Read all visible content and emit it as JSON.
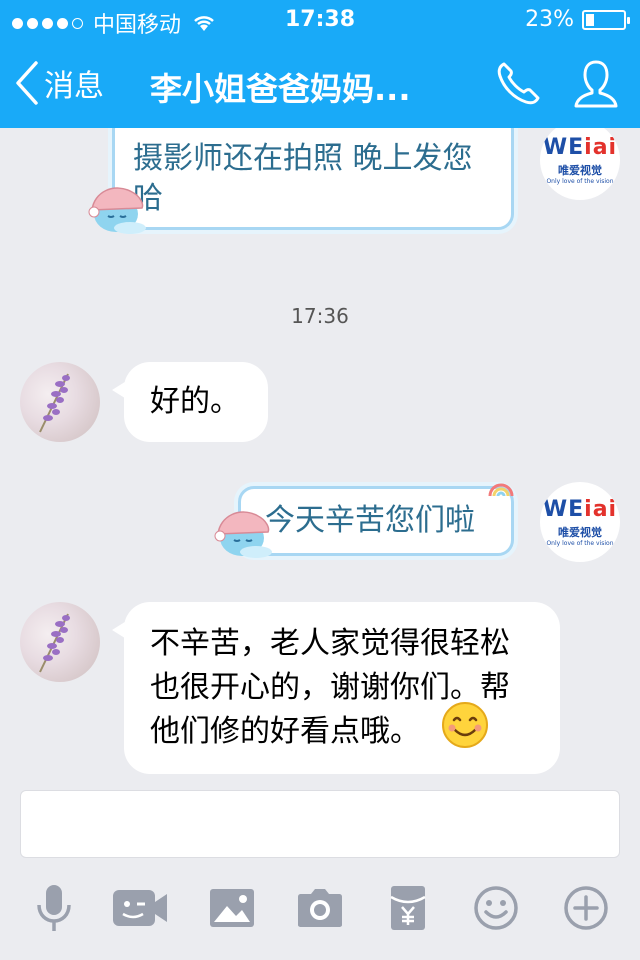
{
  "status": {
    "carrier": "中国移动",
    "time": "17:38",
    "battery": "23%",
    "battery_level": 0.23
  },
  "nav": {
    "back_label": "消息",
    "title": "李小姐爸爸妈妈..."
  },
  "chat": {
    "messages": [
      {
        "from": "me",
        "text": "摄影师还在拍照 晚上发您哈"
      },
      {
        "timestamp": "17:36"
      },
      {
        "from": "other",
        "text": "好的。"
      },
      {
        "from": "me",
        "text": "今天辛苦您们啦"
      },
      {
        "from": "other",
        "text": "不辛苦，老人家觉得很轻松也很开心的，谢谢你们。帮他们修的好看点哦。"
      }
    ],
    "brand_avatar": {
      "logo": "WEiai",
      "cn": "唯爱视觉",
      "en": "Only love of the vision"
    }
  },
  "composer": {
    "input_value": "",
    "tools": [
      "microphone-icon",
      "video-call-icon",
      "image-icon",
      "camera-icon",
      "red-packet-icon",
      "emoji-icon",
      "plus-icon"
    ]
  }
}
